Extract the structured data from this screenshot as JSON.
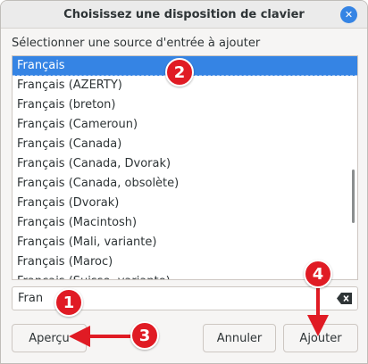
{
  "dialog": {
    "title": "Choisissez une disposition de clavier",
    "close_icon": "close-icon"
  },
  "list": {
    "label": "Sélectionner une source d'entrée à ajouter",
    "selected_index": 0,
    "items": [
      "Français",
      "Français (AZERTY)",
      "Français (breton)",
      "Français (Cameroun)",
      "Français (Canada)",
      "Français (Canada, Dvorak)",
      "Français (Canada, obsolète)",
      "Français (Dvorak)",
      "Français (Macintosh)",
      "Français (Mali, variante)",
      "Français (Maroc)",
      "Français (Suisse, variante)"
    ]
  },
  "search": {
    "value": "Fran",
    "clear_icon": "backspace-icon"
  },
  "buttons": {
    "preview": "Aperçu",
    "cancel": "Annuler",
    "add": "Ajouter"
  },
  "annotations": [
    "1",
    "2",
    "3",
    "4"
  ],
  "colors": {
    "accent": "#3584e4",
    "annotation": "#e01b24"
  }
}
